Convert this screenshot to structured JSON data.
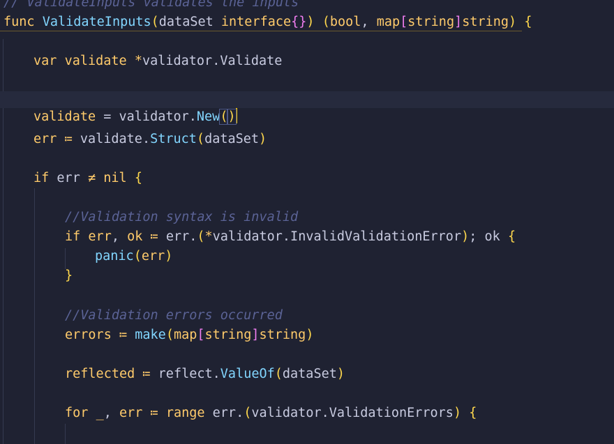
{
  "editor": {
    "lines": [
      [
        [
          "cm",
          "// ValidateInputs validates the inputs"
        ]
      ],
      [
        [
          "kw",
          "func "
        ],
        [
          "fn",
          "ValidateInputs"
        ],
        [
          "br-gold",
          "("
        ],
        [
          "pl",
          "dataSet "
        ],
        [
          "kw",
          "interface"
        ],
        [
          "br-pink",
          "{}"
        ],
        [
          "br-gold",
          ")"
        ],
        [
          "pl",
          " "
        ],
        [
          "br-gold",
          "("
        ],
        [
          "kw",
          "bool"
        ],
        [
          "pl",
          ", "
        ],
        [
          "kw",
          "map"
        ],
        [
          "br-pink",
          "["
        ],
        [
          "kw",
          "string"
        ],
        [
          "br-pink",
          "]"
        ],
        [
          "kw",
          "string"
        ],
        [
          "br-gold",
          ")"
        ],
        [
          "pl",
          " "
        ],
        [
          "br-gold",
          "{"
        ]
      ],
      [
        [
          "kw",
          "var "
        ],
        [
          "kw",
          "validate "
        ],
        [
          "op",
          "*"
        ],
        [
          "pl",
          "validator.Validate"
        ]
      ],
      [
        [
          "kw",
          "validate"
        ],
        [
          "pl",
          " = validator."
        ],
        [
          "fn",
          "New"
        ],
        [
          "br-gold",
          "()"
        ]
      ],
      [
        [
          "kw",
          "err"
        ],
        [
          "pl",
          " "
        ],
        [
          "op",
          "≔"
        ],
        [
          "pl",
          " validate."
        ],
        [
          "fn",
          "Struct"
        ],
        [
          "br-gold",
          "("
        ],
        [
          "pl",
          "dataSet"
        ],
        [
          "br-gold",
          ")"
        ]
      ],
      [
        [
          "kw",
          "if "
        ],
        [
          "pl",
          "err "
        ],
        [
          "op",
          "≠"
        ],
        [
          "pl",
          " "
        ],
        [
          "kw",
          "nil "
        ],
        [
          "br-gold",
          "{"
        ]
      ],
      [
        [
          "cm",
          "//Validation syntax is invalid"
        ]
      ],
      [
        [
          "kw",
          "if "
        ],
        [
          "kw",
          "err"
        ],
        [
          "pl",
          ", "
        ],
        [
          "kw",
          "ok"
        ],
        [
          "pl",
          " "
        ],
        [
          "op",
          "≔"
        ],
        [
          "pl",
          " err."
        ],
        [
          "br-gold",
          "("
        ],
        [
          "op",
          "*"
        ],
        [
          "pl",
          "validator.InvalidValidationError"
        ],
        [
          "br-gold",
          ")"
        ],
        [
          "pl",
          "; ok "
        ],
        [
          "br-gold",
          "{"
        ]
      ],
      [
        [
          "fn",
          "panic"
        ],
        [
          "br-gold",
          "("
        ],
        [
          "kw",
          "err"
        ],
        [
          "br-gold",
          ")"
        ]
      ],
      [
        [
          "br-gold",
          "}"
        ]
      ],
      [
        [
          "cm",
          "//Validation errors occurred"
        ]
      ],
      [
        [
          "kw",
          "errors"
        ],
        [
          "pl",
          " "
        ],
        [
          "op",
          "≔"
        ],
        [
          "pl",
          " "
        ],
        [
          "fn",
          "make"
        ],
        [
          "br-gold",
          "("
        ],
        [
          "kw",
          "map"
        ],
        [
          "br-pink",
          "["
        ],
        [
          "kw",
          "string"
        ],
        [
          "br-pink",
          "]"
        ],
        [
          "kw",
          "string"
        ],
        [
          "br-gold",
          ")"
        ]
      ],
      [
        [
          "kw",
          "reflected"
        ],
        [
          "pl",
          " "
        ],
        [
          "op",
          "≔"
        ],
        [
          "pl",
          " reflect."
        ],
        [
          "fn",
          "ValueOf"
        ],
        [
          "br-gold",
          "("
        ],
        [
          "pl",
          "dataSet"
        ],
        [
          "br-gold",
          ")"
        ]
      ],
      [
        [
          "kw",
          "for "
        ],
        [
          "kw",
          "_"
        ],
        [
          "pl",
          ", "
        ],
        [
          "kw",
          "err"
        ],
        [
          "pl",
          " "
        ],
        [
          "op",
          "≔"
        ],
        [
          "pl",
          " "
        ],
        [
          "kw",
          "range "
        ],
        [
          "pl",
          "err."
        ],
        [
          "br-gold",
          "("
        ],
        [
          "pl",
          "validator.ValidationErrors"
        ],
        [
          "br-gold",
          ")"
        ],
        [
          "pl",
          " "
        ],
        [
          "br-gold",
          "{"
        ]
      ]
    ]
  },
  "theme": {
    "background": "#1f2232",
    "current_line": "#262a3d",
    "caret": "#ffcc00"
  }
}
